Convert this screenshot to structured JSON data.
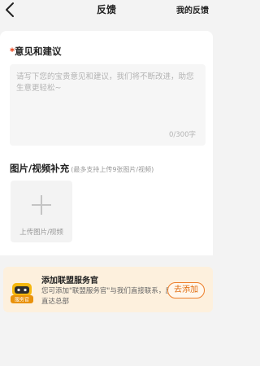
{
  "nav": {
    "title": "反馈",
    "right_link": "我的反馈",
    "back_icon": "chevron-left-icon"
  },
  "form": {
    "required_mark": "*",
    "opinion_title": "意见和建议",
    "textarea_placeholder": "请写下您的宝贵意见和建议，我们将不断改进，助您生意更轻松~",
    "char_count": "0/300字",
    "media_title": "图片/视频补充",
    "media_subtitle": "(最多支持上传9张图片/视频)",
    "upload_label": "上传图片/视频",
    "upload_icon": "plus-icon"
  },
  "banner": {
    "title": "添加联盟服务官",
    "description": "您可添加\"联盟服务官\"与我们直接联系，反馈直达总部",
    "mascot_label": "服务官",
    "button_label": "去添加",
    "accent_color": "#ed7e29",
    "background_color": "#fdf0dd"
  }
}
